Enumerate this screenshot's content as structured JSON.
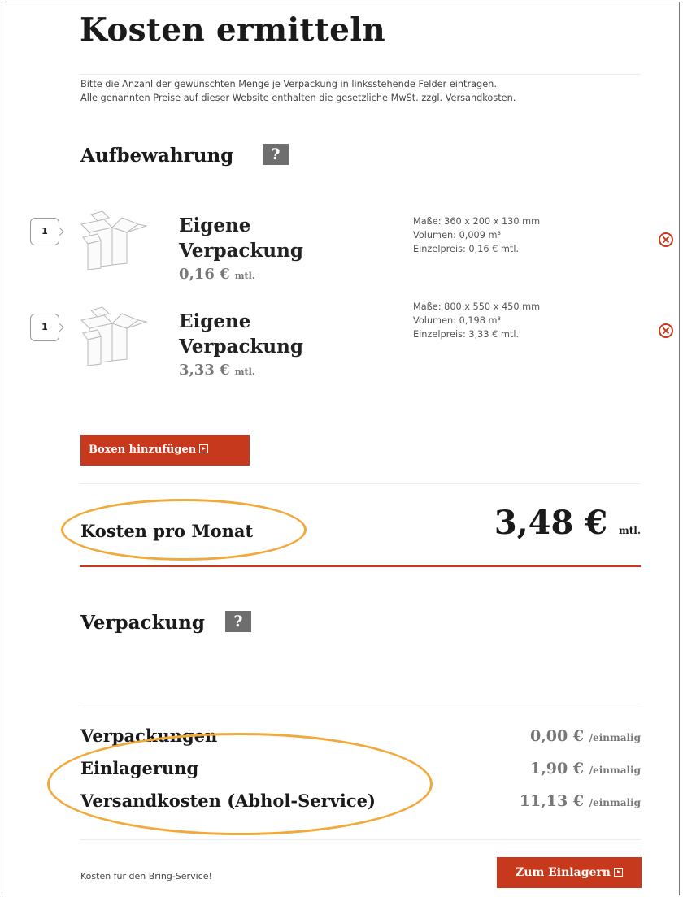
{
  "page": {
    "title": "Kosten ermitteln",
    "intro_line1": "Bitte die Anzahl der gewünschten Menge je Verpackung in linksstehende Felder eintragen.",
    "intro_line2": "Alle genannten Preise auf dieser Website enthalten die gesetzliche MwSt. zzgl. Versandkosten."
  },
  "storage": {
    "title": "Aufbewahrung",
    "help": "?",
    "items": [
      {
        "qty": "1",
        "name_line1": "Eigene",
        "name_line2": "Verpackung",
        "price": "0,16 €",
        "price_unit": "mtl.",
        "dimensions": "Maße: 360 x 200 x 130 mm",
        "volume": "Volumen: 0,009 m³",
        "unit_price": "Einzelpreis: 0,16 € mtl."
      },
      {
        "qty": "1",
        "name_line1": "Eigene",
        "name_line2": "Verpackung",
        "price": "3,33 €",
        "price_unit": "mtl.",
        "dimensions": "Maße: 800 x 550 x 450 mm",
        "volume": "Volumen: 0,198 m³",
        "unit_price": "Einzelpreis: 3,33 € mtl."
      }
    ],
    "add_button": "Boxen hinzufügen"
  },
  "monthly": {
    "label": "Kosten pro Monat",
    "total": "3,48 €",
    "unit": "mtl."
  },
  "packaging": {
    "title": "Verpackung",
    "help": "?"
  },
  "summary": [
    {
      "label": "Verpackungen",
      "value": "0,00 €",
      "unit": "/einmalig"
    },
    {
      "label": "Einlagerung",
      "value": "1,90 €",
      "unit": "/einmalig"
    },
    {
      "label": "Versandkosten (Abhol-Service)",
      "value": "11,13 €",
      "unit": "/einmalig"
    }
  ],
  "footer": {
    "note": "Kosten für den Bring-Service!",
    "submit_button": "Zum Einlagern"
  },
  "colors": {
    "accent": "#c7391c",
    "highlight": "#f2a93b",
    "badge": "#6e6e6e"
  }
}
